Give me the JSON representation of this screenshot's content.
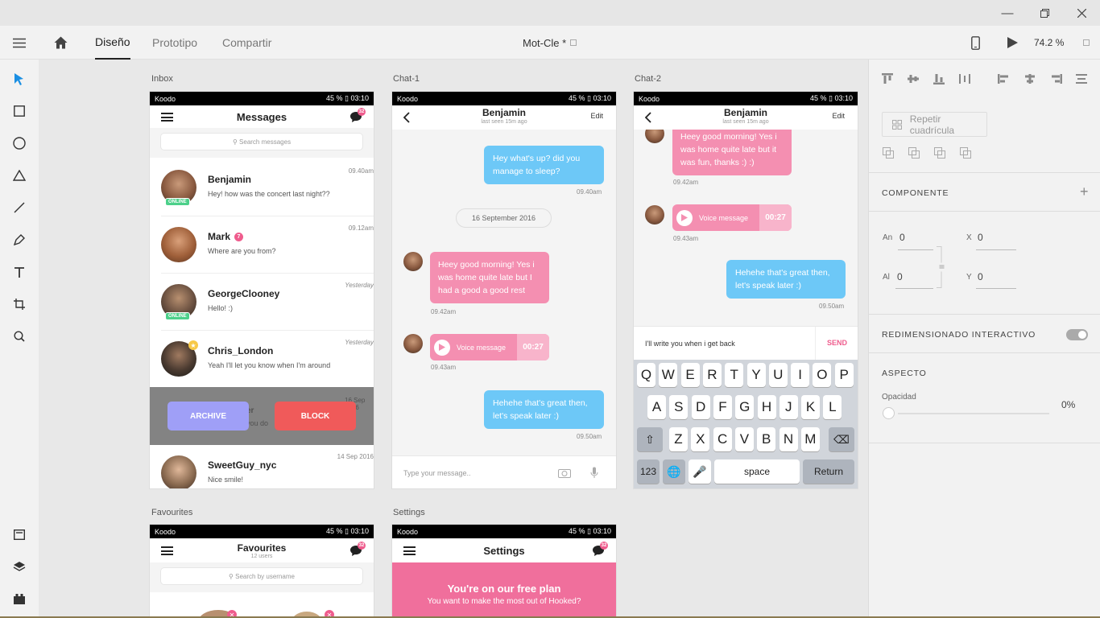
{
  "toolbar": {
    "tab_design": "Diseño",
    "tab_prototype": "Prototipo",
    "tab_share": "Compartir",
    "doc_title": "Mot-Cle *",
    "zoom": "74.2 %"
  },
  "artboards": {
    "inbox": "Inbox",
    "chat1": "Chat-1",
    "chat2": "Chat-2",
    "favourites": "Favourites",
    "settings": "Settings"
  },
  "status": {
    "carrier": "Koodo",
    "signal": "45 %",
    "time": "03:10"
  },
  "inbox": {
    "title": "Messages",
    "badge": "32",
    "search": "Search messages",
    "messages": [
      {
        "name": "Benjamin",
        "preview": "Hey! how was the concert last night??",
        "time": "09.40am",
        "tag": "ONLINE"
      },
      {
        "name": "Mark",
        "preview": "Where are you from?",
        "time": "09.12am",
        "badge": "7"
      },
      {
        "name": "GeorgeClooney",
        "preview": "Hello! :)",
        "time": "Yesterday",
        "tag": "ONLINE"
      },
      {
        "name": "Chris_London",
        "preview": "Yeah I'll let you know when I'm around",
        "time": "Yesterday"
      },
      {
        "name": "SweetGuy_nyc",
        "preview": "Nice smile!",
        "time": "14 Sep 2016"
      }
    ],
    "swipe": {
      "archive": "ARCHIVE",
      "block": "BLOCK",
      "hidden_time": "16 Sep 2016",
      "hidden_name": "er",
      "hidden_preview": "you do"
    }
  },
  "chat1": {
    "name": "Benjamin",
    "subtitle": "last seen 15m ago",
    "edit": "Edit",
    "m1": "Hey what's up? did you manage to sleep?",
    "t1": "09.40am",
    "date": "16 September 2016",
    "m2": "Heey good morning! Yes i was home quite late but I had a good a good rest",
    "t2": "09.42am",
    "voice": "Voice message",
    "voice_dur": "00:27",
    "t3": "09.43am",
    "m3": "Hehehe that's great then, let's speak later :)",
    "t4": "09.50am",
    "placeholder": "Type your message.."
  },
  "chat2": {
    "name": "Benjamin",
    "subtitle": "last seen 15m ago",
    "edit": "Edit",
    "m1": "Heey good morning! Yes i was home quite late but it was fun, thanks :) :)",
    "t1": "09.42am",
    "voice": "Voice message",
    "voice_dur": "00:27",
    "t2": "09.43am",
    "m2": "Hehehe that's great then, let's speak later :)",
    "t3": "09.50am",
    "input": "I'll write you when i get back",
    "send": "SEND",
    "keys": {
      "row1": [
        "Q",
        "W",
        "E",
        "R",
        "T",
        "Y",
        "U",
        "I",
        "O",
        "P"
      ],
      "row2": [
        "A",
        "S",
        "D",
        "F",
        "G",
        "H",
        "J",
        "K",
        "L"
      ],
      "row3": [
        "Z",
        "X",
        "C",
        "V",
        "B",
        "N",
        "M"
      ],
      "num": "123",
      "space": "space",
      "ret": "Return"
    }
  },
  "favourites": {
    "title": "Favourites",
    "sub": "12 users",
    "badge": "32",
    "search": "Search by username"
  },
  "settings": {
    "title": "Settings",
    "badge": "32",
    "promo_title": "You're on our free plan",
    "promo_sub": "You want to make the most out of Hooked?"
  },
  "panel": {
    "repeat": "Repetir cuadrícula",
    "component": "COMPONENTE",
    "w_label": "An",
    "w": "0",
    "x_label": "X",
    "x": "0",
    "h_label": "Al",
    "h": "0",
    "y_label": "Y",
    "y": "0",
    "responsive": "REDIMENSIONADO INTERACTIVO",
    "appearance": "ASPECTO",
    "opacity_label": "Opacidad",
    "opacity": "0%"
  },
  "colors": {
    "pink": "#f48fb1",
    "blue": "#6dc8f7",
    "archive": "#9f9ff7",
    "block": "#f05a5a",
    "accent": "#1a8fe3"
  }
}
